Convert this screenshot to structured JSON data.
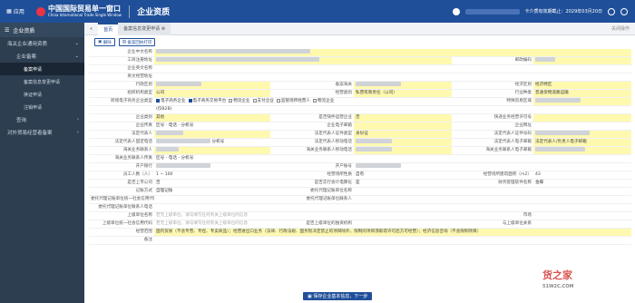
{
  "topbar": {
    "app_label": "应用",
    "brand_cn": "中国国际贸易单一窗口",
    "brand_en": "China International Trade Single Window",
    "module": "企业资质",
    "card_expiry": "卡介质有效期截止：2029年03月20日"
  },
  "sidebar": {
    "header": "企业资质",
    "items": [
      {
        "label": "海关企业通用资质",
        "level": 1
      },
      {
        "label": "企业备案",
        "level": 2
      },
      {
        "label": "备案申请",
        "level": 3,
        "active": true
      },
      {
        "label": "备案信息变更申请",
        "level": 3
      },
      {
        "label": "换证申请",
        "level": 3
      },
      {
        "label": "注销申请",
        "level": 3
      },
      {
        "label": "查询",
        "level": 2
      },
      {
        "label": "对外贸易经营者备案",
        "level": 1
      }
    ]
  },
  "tabs": {
    "home": "首页",
    "current": "备案信息变更申请",
    "close_others": "关闭操作"
  },
  "toolbar": {
    "delete": "删除",
    "print": "备案回执打印"
  },
  "form": {
    "r1": {
      "l1": "企业中文名称"
    },
    "r2": {
      "l1": "工商注册地址",
      "l2": "邮政编码"
    },
    "r3": {
      "l1": "企业英文名称"
    },
    "r4": {
      "l1": "英文经营地址"
    },
    "r5": {
      "l1": "行政区划",
      "l2": "备案海关",
      "l3": "经济区划",
      "v3": "经济特区"
    },
    "r6": {
      "l1": "组织机构类型",
      "v1": "公司",
      "l2": "经营类别",
      "v2": "私营有限责任（公司）",
      "l3": "行业种类",
      "v3": "普通货物道路运输"
    },
    "r7": {
      "l1": "跨境电子商务企业类型",
      "opts": [
        "电子商务企业",
        "电子商务交易平台",
        "物流企业",
        "支付企业",
        "监管场所经营人",
        "物流企业",
        "(仅B2B)"
      ],
      "l3": "特殊贸易区域"
    },
    "r8": {
      "l1": "企业类别",
      "v1": "其他",
      "l2": "是否快件运营企业",
      "l3": "快递业务经营许可号"
    },
    "r9": {
      "l1": "企业传真",
      "v1": "区号 - 电话 - 分机号",
      "l2": "企业电子邮箱",
      "l3": "企业网址"
    },
    "r10": {
      "l1": "法定代表人",
      "l2": "法定代表人证件类型",
      "v2": "身份证",
      "l3": "法定代表人证件号码"
    },
    "r11": {
      "l1": "法定代表人固定电话",
      "v1": "分机号",
      "l2": "法定代表人移动电话",
      "l3": "法定代表人电子邮箱",
      "v3": "法定代表人/负责人电子邮箱"
    },
    "r12": {
      "l1": "海关业务联系人",
      "l2": "海关业务联系人移动电话",
      "l3": "海关业务联系人电子邮箱"
    },
    "r13": {
      "l1": "海关业务联系人传真",
      "v1": "区号 - 电话 - 分机号"
    },
    "r14": {
      "l1": "开户银行",
      "l2": "开户账号"
    },
    "r15": {
      "l1": "员工人数（人）",
      "v1": "1 ~ 100",
      "l2": "经营场所性质",
      "v2": "自有",
      "l3": "经营场所建筑面积（m2）",
      "v3": "43"
    },
    "r16": {
      "l1": "是否上市公司",
      "v1": "否",
      "l2": "是否实行会计电算化",
      "v2": "是",
      "l3": "财务管理软件名称",
      "v3": "金蝶"
    },
    "r17": {
      "l1": "记账方式",
      "v1": "自理记账",
      "l2": "委托代理记账单位名称"
    },
    "r18": {
      "l1": "委托代理记账单位统一社会信用代码",
      "l2": "委托代理记账单位联系人"
    },
    "r19": {
      "l1": "委托代理记账单位联系人电话"
    },
    "r20": {
      "l1": "上级单位名称",
      "v1": "若无上级单位，请勾填写任何有关上级单位的信息",
      "l3": "市场"
    },
    "r21": {
      "l1": "上级单位统一社会信用代码",
      "v1": "若无上级单位，请勾填写任何有关上级单位的信息",
      "l2": "是否上级单位的独资机构",
      "l3": "与上级单位关系"
    },
    "r22": {
      "l1": "经营范围",
      "v1": "国内贸易（不含专营、专控、专卖商品）；经营进出口业务（法律、行政法规、国务院决定禁止的项目除外，限制的项目须取得许可后方可经营）；经济信息咨询（不含限制项目）"
    },
    "r23": {
      "l1": "备注"
    }
  },
  "save_button": "保存企业基本信息，下一步",
  "watermark": {
    "main": "货之家",
    "sub": "51W2C.COM"
  }
}
